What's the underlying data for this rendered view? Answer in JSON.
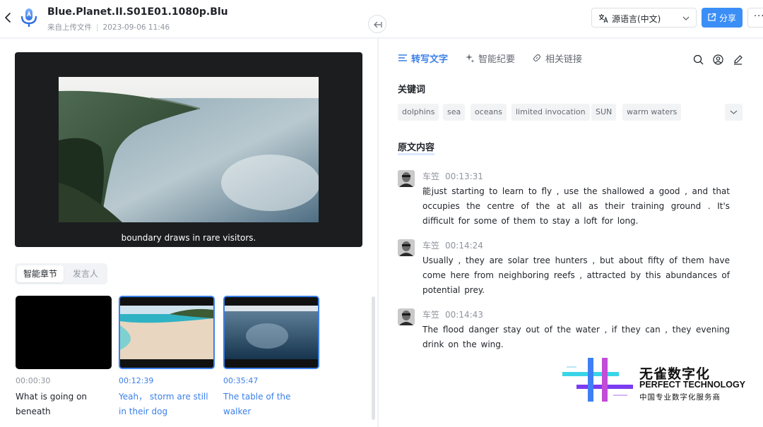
{
  "header": {
    "title": "Blue.Planet.II.S01E01.1080p.Blu",
    "source": "来自上传文件",
    "separator": "|",
    "date": "2023-09-06 11:46",
    "language_select": "源语言(中文)",
    "share_label": "分享",
    "more_label": "···"
  },
  "video": {
    "subtitle": "boundary draws in rare visitors."
  },
  "left_tabs": {
    "chapters": "智能章节",
    "speakers": "发言人"
  },
  "chapters": [
    {
      "time": "00:00:30",
      "title": "What is going on beneath"
    },
    {
      "time": "00:12:39",
      "title": "Yeah， storm are still in their dog"
    },
    {
      "time": "00:35:47",
      "title": "The table of the walker"
    }
  ],
  "right_tabs": [
    {
      "label": "转写文字",
      "icon": "list-icon"
    },
    {
      "label": "智能纪要",
      "icon": "sparkle-icon"
    },
    {
      "label": "相关链接",
      "icon": "link-icon"
    }
  ],
  "keywords_title": "关键词",
  "keywords": [
    "dolphins",
    "sea",
    "oceans",
    "limited invocation",
    "SUN",
    "warm waters"
  ],
  "transcript_title": "原文内容",
  "transcript": [
    {
      "speaker": "车笠",
      "time": "00:13:31",
      "text": "能just starting to learn to fly , use the shallowed a good , and that occupies the centre of the at all as their training ground . It's difficult for some of them to stay a loft for long."
    },
    {
      "speaker": "车笠",
      "time": "00:14:24",
      "text": "Usually , they are solar tree hunters , but about fifty of them have come here from neighboring reefs , attracted by this abundances of potential prey."
    },
    {
      "speaker": "车笠",
      "time": "00:14:43",
      "text": "The flood danger stay out of the water , if they can , they evening drink on the wing."
    }
  ],
  "watermark": {
    "cn": "无雀数字化",
    "en": "PERFECT TECHNOLOGY",
    "sub": "中国专业数字化服务商"
  },
  "colors": {
    "accent": "#3b7fe8",
    "share_button": "#3b8ef6"
  }
}
